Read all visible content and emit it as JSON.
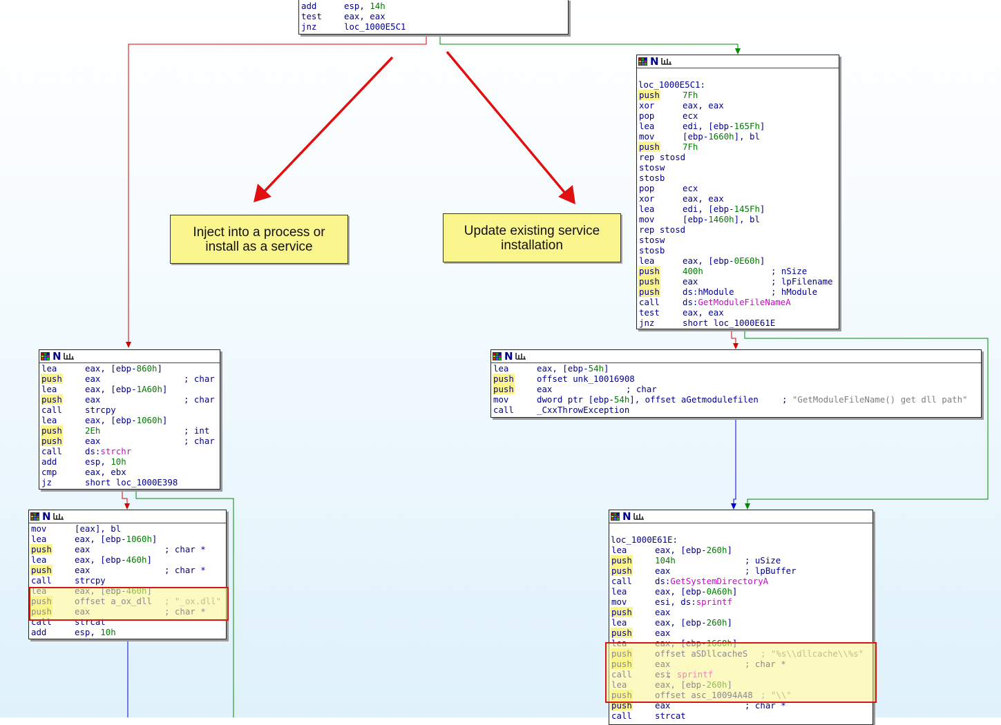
{
  "annotations": {
    "inject_label": "Inject into a process or install as a service",
    "update_label": "Update existing service installation"
  },
  "nodes": {
    "top": [
      {
        "m": "add",
        "o": [
          [
            "t",
            "esp, "
          ],
          [
            "n",
            "14h"
          ]
        ]
      },
      {
        "m": "test",
        "o": [
          [
            "t",
            "eax, eax"
          ]
        ]
      },
      {
        "m": "jnz",
        "o": [
          [
            "t",
            "loc_1000E5C1"
          ]
        ]
      }
    ],
    "right_top": [
      {
        "label": "loc_1000E5C1:"
      },
      {
        "m": "push",
        "hl": true,
        "o": [
          [
            "n",
            "7Fh"
          ]
        ]
      },
      {
        "m": "xor",
        "o": [
          [
            "t",
            "eax, eax"
          ]
        ]
      },
      {
        "m": "pop",
        "o": [
          [
            "t",
            "ecx"
          ]
        ]
      },
      {
        "m": "lea",
        "o": [
          [
            "t",
            "edi, [ebp-"
          ],
          [
            "n",
            "165Fh"
          ],
          [
            "t",
            "]"
          ]
        ]
      },
      {
        "m": "mov",
        "o": [
          [
            "t",
            "[ebp-"
          ],
          [
            "n",
            "1660h"
          ],
          [
            "t",
            "], bl"
          ]
        ]
      },
      {
        "m": "push",
        "hl": true,
        "o": [
          [
            "n",
            "7Fh"
          ]
        ]
      },
      {
        "m": "rep stosd",
        "o": []
      },
      {
        "m": "stosw",
        "o": []
      },
      {
        "m": "stosb",
        "o": []
      },
      {
        "m": "pop",
        "o": [
          [
            "t",
            "ecx"
          ]
        ]
      },
      {
        "m": "xor",
        "o": [
          [
            "t",
            "eax, eax"
          ]
        ]
      },
      {
        "m": "lea",
        "o": [
          [
            "t",
            "edi, [ebp-"
          ],
          [
            "n",
            "145Fh"
          ],
          [
            "t",
            "]"
          ]
        ]
      },
      {
        "m": "mov",
        "o": [
          [
            "t",
            "[ebp-"
          ],
          [
            "n",
            "1460h"
          ],
          [
            "t",
            "], bl"
          ]
        ]
      },
      {
        "m": "rep stosd",
        "o": []
      },
      {
        "m": "stosw",
        "o": []
      },
      {
        "m": "stosb",
        "o": []
      },
      {
        "m": "lea",
        "o": [
          [
            "t",
            "eax, [ebp-"
          ],
          [
            "n",
            "0E60h"
          ],
          [
            "t",
            "]"
          ]
        ]
      },
      {
        "m": "push",
        "hl": true,
        "o": [
          [
            "n",
            "400h"
          ]
        ],
        "c": [
          [
            "c",
            "; nSize"
          ]
        ]
      },
      {
        "m": "push",
        "hl": true,
        "o": [
          [
            "t",
            "eax"
          ]
        ],
        "c": [
          [
            "c",
            "; lpFilename"
          ]
        ]
      },
      {
        "m": "push",
        "hl": true,
        "o": [
          [
            "t",
            "ds:hModule"
          ]
        ],
        "c": [
          [
            "c",
            "; hModule"
          ]
        ]
      },
      {
        "m": "call",
        "o": [
          [
            "t",
            "ds:"
          ],
          [
            "i",
            "GetModuleFileNameA"
          ]
        ]
      },
      {
        "m": "test",
        "o": [
          [
            "t",
            "eax, eax"
          ]
        ]
      },
      {
        "m": "jnz",
        "o": [
          [
            "t",
            "short loc_1000E61E"
          ]
        ]
      }
    ],
    "left_mid": [
      {
        "m": "lea",
        "o": [
          [
            "t",
            "eax, [ebp-"
          ],
          [
            "n",
            "860h"
          ],
          [
            "t",
            "]"
          ]
        ]
      },
      {
        "m": "push",
        "hl": true,
        "o": [
          [
            "t",
            "eax"
          ]
        ],
        "c": [
          [
            "c",
            "; char *"
          ]
        ]
      },
      {
        "m": "lea",
        "o": [
          [
            "t",
            "eax, [ebp-"
          ],
          [
            "n",
            "1A60h"
          ],
          [
            "t",
            "]"
          ]
        ]
      },
      {
        "m": "push",
        "hl": true,
        "o": [
          [
            "t",
            "eax"
          ]
        ],
        "c": [
          [
            "c",
            "; char *"
          ]
        ]
      },
      {
        "m": "call",
        "o": [
          [
            "t",
            "strcpy"
          ]
        ]
      },
      {
        "m": "lea",
        "o": [
          [
            "t",
            "eax, [ebp-"
          ],
          [
            "n",
            "1060h"
          ],
          [
            "t",
            "]"
          ]
        ]
      },
      {
        "m": "push",
        "hl": true,
        "o": [
          [
            "n",
            "2Eh"
          ]
        ],
        "c": [
          [
            "c",
            "; int"
          ]
        ]
      },
      {
        "m": "push",
        "hl": true,
        "o": [
          [
            "t",
            "eax"
          ]
        ],
        "c": [
          [
            "c",
            "; char *"
          ]
        ]
      },
      {
        "m": "call",
        "o": [
          [
            "t",
            "ds:"
          ],
          [
            "i",
            "strchr"
          ]
        ]
      },
      {
        "m": "add",
        "o": [
          [
            "t",
            "esp, "
          ],
          [
            "n",
            "10h"
          ]
        ]
      },
      {
        "m": "cmp",
        "o": [
          [
            "t",
            "eax, ebx"
          ]
        ]
      },
      {
        "m": "jz",
        "o": [
          [
            "t",
            "short loc_1000E398"
          ]
        ]
      }
    ],
    "right_mid": [
      {
        "m": "lea",
        "o": [
          [
            "t",
            "eax, [ebp-"
          ],
          [
            "n",
            "54h"
          ],
          [
            "t",
            "]"
          ]
        ]
      },
      {
        "m": "push",
        "hl": true,
        "o": [
          [
            "t",
            "offset unk_10016908"
          ]
        ]
      },
      {
        "m": "push",
        "hl": true,
        "o": [
          [
            "t",
            "eax"
          ]
        ],
        "c": [
          [
            "c",
            "; char"
          ]
        ]
      },
      {
        "m": "mov",
        "o": [
          [
            "t",
            "dword ptr [ebp-"
          ],
          [
            "n",
            "54h"
          ],
          [
            "t",
            "], offset aGetmodulefilen"
          ]
        ],
        "c": [
          [
            "c",
            "; "
          ],
          [
            "s",
            "\"GetModuleFileName() get dll path\""
          ]
        ]
      },
      {
        "m": "call",
        "o": [
          [
            "t",
            "_CxxThrowException"
          ]
        ]
      }
    ],
    "left_bottom": [
      {
        "m": "mov",
        "o": [
          [
            "t",
            "[eax], bl"
          ]
        ]
      },
      {
        "m": "lea",
        "o": [
          [
            "t",
            "eax, [ebp-"
          ],
          [
            "n",
            "1060h"
          ],
          [
            "t",
            "]"
          ]
        ]
      },
      {
        "m": "push",
        "hl": true,
        "o": [
          [
            "t",
            "eax"
          ]
        ],
        "c": [
          [
            "c",
            "; char *"
          ]
        ]
      },
      {
        "m": "lea",
        "o": [
          [
            "t",
            "eax, [ebp-"
          ],
          [
            "n",
            "460h"
          ],
          [
            "t",
            "]"
          ]
        ]
      },
      {
        "m": "push",
        "hl": true,
        "o": [
          [
            "t",
            "eax"
          ]
        ],
        "c": [
          [
            "c",
            "; char *"
          ]
        ]
      },
      {
        "m": "call",
        "o": [
          [
            "t",
            "strcpy"
          ]
        ]
      },
      {
        "m": "lea",
        "o": [
          [
            "t",
            "eax, [ebp-"
          ],
          [
            "n",
            "460h"
          ],
          [
            "t",
            "]"
          ]
        ]
      },
      {
        "m": "push",
        "hl": true,
        "o": [
          [
            "t",
            "offset a_ox_dll"
          ]
        ],
        "c": [
          [
            "s",
            "; \"_ox.dll\""
          ]
        ]
      },
      {
        "m": "push",
        "hl": true,
        "o": [
          [
            "t",
            "eax"
          ]
        ],
        "c": [
          [
            "c",
            "; char *"
          ]
        ]
      },
      {
        "m": "call",
        "o": [
          [
            "t",
            "strcat"
          ]
        ]
      },
      {
        "m": "add",
        "o": [
          [
            "t",
            "esp, "
          ],
          [
            "n",
            "10h"
          ]
        ]
      }
    ],
    "right_bottom": [
      {
        "label": "loc_1000E61E:"
      },
      {
        "m": "lea",
        "o": [
          [
            "t",
            "eax, [ebp-"
          ],
          [
            "n",
            "260h"
          ],
          [
            "t",
            "]"
          ]
        ]
      },
      {
        "m": "push",
        "hl": true,
        "o": [
          [
            "n",
            "104h"
          ]
        ],
        "c": [
          [
            "c",
            "; uSize"
          ]
        ]
      },
      {
        "m": "push",
        "hl": true,
        "o": [
          [
            "t",
            "eax"
          ]
        ],
        "c": [
          [
            "c",
            "; lpBuffer"
          ]
        ]
      },
      {
        "m": "call",
        "o": [
          [
            "t",
            "ds:"
          ],
          [
            "i",
            "GetSystemDirectoryA"
          ]
        ]
      },
      {
        "m": "lea",
        "o": [
          [
            "t",
            "eax, [ebp-"
          ],
          [
            "n",
            "0A60h"
          ],
          [
            "t",
            "]"
          ]
        ]
      },
      {
        "m": "mov",
        "o": [
          [
            "t",
            "esi, ds:"
          ],
          [
            "i",
            "sprintf"
          ]
        ]
      },
      {
        "m": "push",
        "hl": true,
        "o": [
          [
            "t",
            "eax"
          ]
        ]
      },
      {
        "m": "lea",
        "o": [
          [
            "t",
            "eax, [ebp-"
          ],
          [
            "n",
            "260h"
          ],
          [
            "t",
            "]"
          ]
        ]
      },
      {
        "m": "push",
        "hl": true,
        "o": [
          [
            "t",
            "eax"
          ]
        ]
      },
      {
        "m": "lea",
        "o": [
          [
            "t",
            "eax, [ebp-"
          ],
          [
            "n",
            "1660h"
          ],
          [
            "t",
            "]"
          ]
        ]
      },
      {
        "m": "push",
        "hl": true,
        "o": [
          [
            "t",
            "offset aSDllcacheS"
          ]
        ],
        "c": [
          [
            "s",
            "; \"%s\\\\dllcache\\\\%s\""
          ]
        ]
      },
      {
        "m": "push",
        "hl": true,
        "o": [
          [
            "t",
            "eax"
          ]
        ],
        "c": [
          [
            "c",
            "; char *"
          ]
        ]
      },
      {
        "m": "call",
        "o": [
          [
            "t",
            "esi"
          ]
        ],
        "c": [
          [
            "c",
            "; "
          ],
          [
            "i",
            "sprintf"
          ]
        ]
      },
      {
        "m": "lea",
        "o": [
          [
            "t",
            "eax, [ebp-"
          ],
          [
            "n",
            "260h"
          ],
          [
            "t",
            "]"
          ]
        ]
      },
      {
        "m": "push",
        "hl": true,
        "o": [
          [
            "t",
            "offset asc_10094A48"
          ]
        ],
        "c": [
          [
            "s",
            "; \"\\\\\""
          ]
        ]
      },
      {
        "m": "push",
        "hl": true,
        "o": [
          [
            "t",
            "eax"
          ]
        ],
        "c": [
          [
            "c",
            "; char *"
          ]
        ]
      },
      {
        "m": "call",
        "o": [
          [
            "t",
            "strcat"
          ]
        ]
      }
    ]
  }
}
